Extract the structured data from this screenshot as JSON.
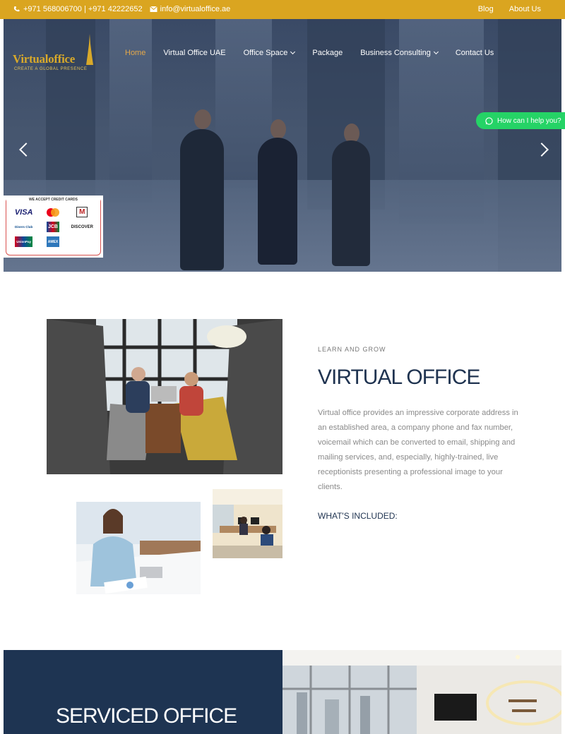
{
  "topbar": {
    "phone": "+971 568006700 | +971 42222652",
    "email": "info@virtualoffice.ae",
    "links": [
      "Blog",
      "About Us"
    ]
  },
  "logo": {
    "name": "Virtualoffice",
    "tagline": "CREATE A GLOBAL PRESENCE"
  },
  "nav": {
    "items": [
      "Home",
      "Virtual Office UAE",
      "Office Space",
      "Package",
      "Business Consulting",
      "Contact Us"
    ]
  },
  "whatsapp": {
    "label": "How can I help you?"
  },
  "cards": {
    "title": "WE ACCEPT CREDIT CARDS",
    "items": [
      "VISA",
      "Mastercard",
      "M",
      "Diners Club",
      "JCB",
      "DISCOVER",
      "UnionPay",
      "AMEX"
    ]
  },
  "about": {
    "eyebrow": "LEARN AND GROW",
    "title": "VIRTUAL OFFICE",
    "description": "Virtual office provides an impressive corporate address in an established area, a company phone and fax number, voicemail which can be converted to email, shipping and mailing services, and, especially, highly-trained, live receptionists presenting a professional image to your clients.",
    "included": "WHAT'S INCLUDED:"
  },
  "serviced": {
    "title": "SERVICED OFFICE"
  },
  "colors": {
    "topbar": "#daa520",
    "navy": "#1e3452",
    "whatsapp": "#25d366",
    "active": "#e4a84a"
  }
}
